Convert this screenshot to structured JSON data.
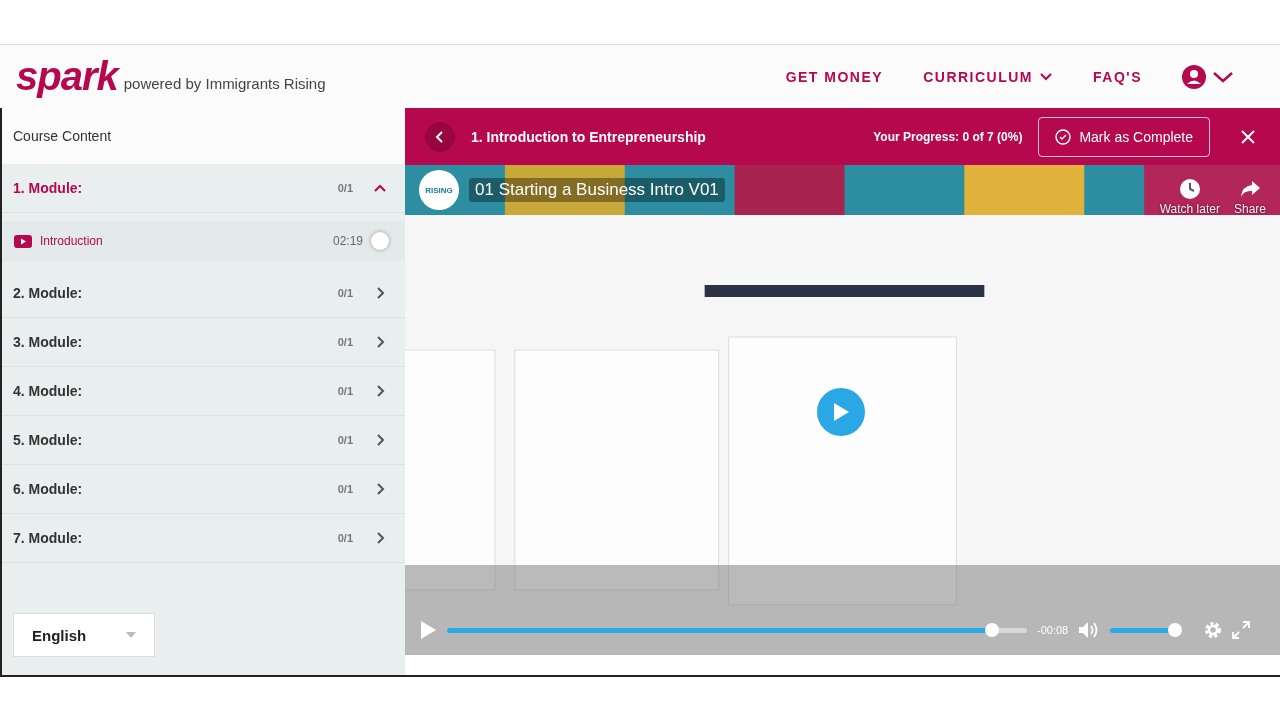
{
  "header": {
    "logo": "spark",
    "tagline": "powered by Immigrants Rising",
    "nav": [
      {
        "label": "GET MONEY",
        "dropdown": false
      },
      {
        "label": "CURRICULUM",
        "dropdown": true
      },
      {
        "label": "FAQ'S",
        "dropdown": false
      }
    ]
  },
  "sidebar": {
    "title": "Course Content",
    "modules": [
      {
        "label": "1. Module:",
        "count": "0/1",
        "expanded": true,
        "children": [
          {
            "label": "Introduction",
            "duration": "02:19",
            "checked": false
          }
        ]
      },
      {
        "label": "2. Module:",
        "count": "0/1",
        "expanded": false
      },
      {
        "label": "3. Module:",
        "count": "0/1",
        "expanded": false
      },
      {
        "label": "4. Module:",
        "count": "0/1",
        "expanded": false
      },
      {
        "label": "5. Module:",
        "count": "0/1",
        "expanded": false
      },
      {
        "label": "6. Module:",
        "count": "0/1",
        "expanded": false
      },
      {
        "label": "7. Module:",
        "count": "0/1",
        "expanded": false
      }
    ],
    "language": "English"
  },
  "lesson_bar": {
    "title": "1. Introduction to Entrepreneurship",
    "progress": "Your Progress: 0 of 7 (0%)",
    "button": "Mark as Complete"
  },
  "video": {
    "channel_badge": "RISING",
    "title": "01 Starting a Business Intro V01",
    "actions": [
      {
        "kind": "clock",
        "label": "Watch later"
      },
      {
        "kind": "share",
        "label": "Share"
      }
    ],
    "seek": {
      "level": 0.94
    },
    "time": "-00:08",
    "volume": {
      "level": 0.93
    }
  }
}
